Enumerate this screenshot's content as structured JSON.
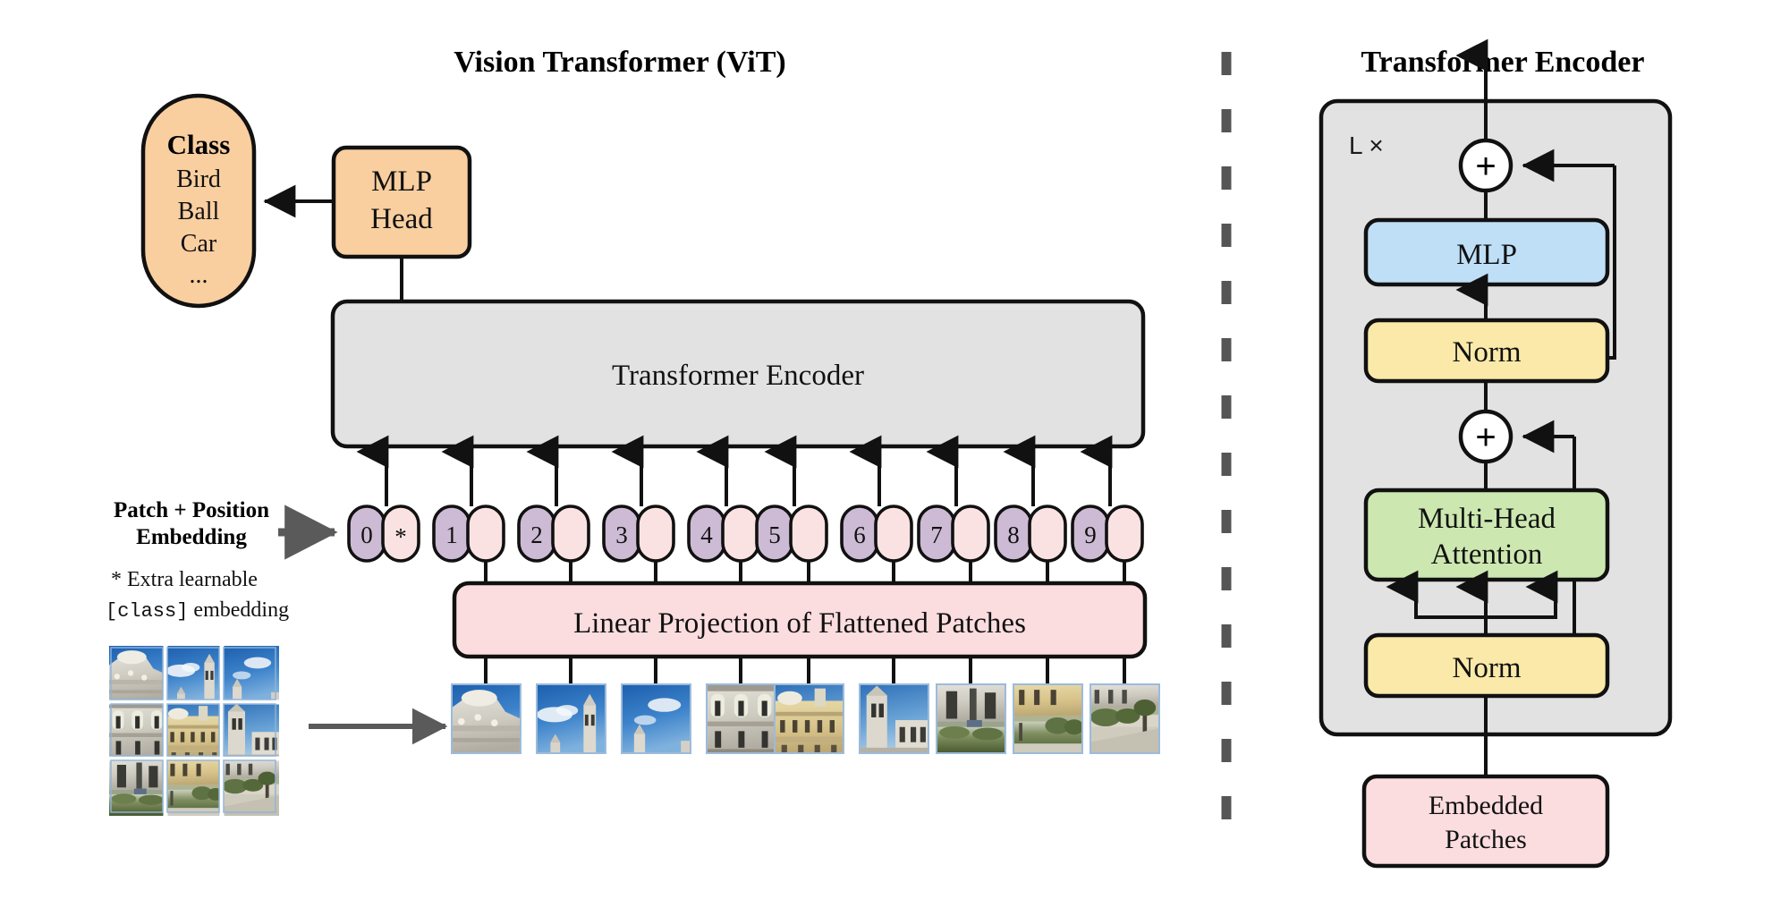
{
  "figure": {
    "left_panel_title": "Vision Transformer (ViT)",
    "right_panel_title": "Transformer Encoder"
  },
  "colors": {
    "orange": "#F9CFA0",
    "gray_box": "#E2E2E2",
    "pink": "#FBDDDF",
    "pink_light": "#FBE2E2",
    "purple": "#CDBAD4",
    "blue": "#BFDFF7",
    "yellow": "#FAE9A8",
    "green": "#CCE8B0",
    "white": "#FFFFFF",
    "outline": "#111111",
    "divider": "#555555",
    "arrow_gray": "#5A5A5A"
  },
  "left": {
    "class_box": {
      "heading": "Class",
      "items": [
        "Bird",
        "Ball",
        "Car",
        "..."
      ]
    },
    "mlp_head": {
      "line1": "MLP",
      "line2": "Head"
    },
    "encoder_box_label": "Transformer Encoder",
    "patch_position_label": {
      "line1": "Patch + Position",
      "line2": "Embedding"
    },
    "extra_note": {
      "line1": "* Extra learnable",
      "mono": "[class]",
      "line2_tail": " embedding"
    },
    "linear_projection_label": "Linear Projection of Flattened Patches",
    "tokens": [
      {
        "num": "0",
        "star": "*"
      },
      {
        "num": "1",
        "star": ""
      },
      {
        "num": "2",
        "star": ""
      },
      {
        "num": "3",
        "star": ""
      },
      {
        "num": "4",
        "star": ""
      },
      {
        "num": "5",
        "star": ""
      },
      {
        "num": "6",
        "star": ""
      },
      {
        "num": "7",
        "star": ""
      },
      {
        "num": "8",
        "star": ""
      },
      {
        "num": "9",
        "star": ""
      }
    ],
    "source_image_grid": {
      "rows": 3,
      "cols": 3,
      "description": "photograph of a baroque palace split into a 3 by 3 grid of patches"
    },
    "patch_strip_count": 9
  },
  "right": {
    "loop_label": "L ×",
    "blocks": {
      "mlp": "MLP",
      "norm_upper": "Norm",
      "attention_line1": "Multi-Head",
      "attention_line2": "Attention",
      "norm_lower": "Norm",
      "embedded_patches_line1": "Embedded",
      "embedded_patches_line2": "Patches"
    },
    "adder_symbol": "+"
  }
}
